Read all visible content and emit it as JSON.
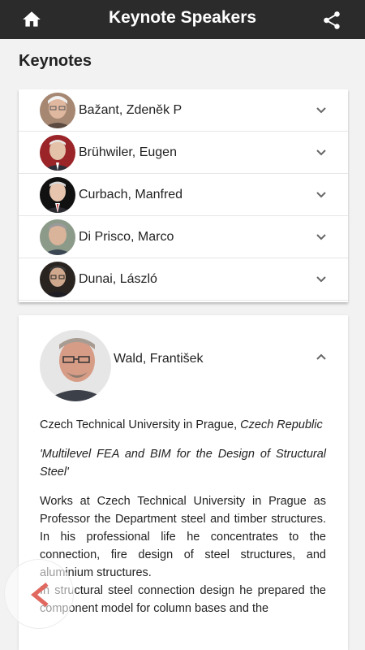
{
  "header": {
    "title": "Keynote Speakers",
    "home_icon": "home-icon",
    "share_icon": "share-icon"
  },
  "section_title": "Keynotes",
  "speakers": [
    {
      "name": "Bažant, Zdeněk P",
      "expanded": false
    },
    {
      "name": "Brühwiler, Eugen",
      "expanded": false
    },
    {
      "name": "Curbach, Manfred",
      "expanded": false
    },
    {
      "name": "Di Prisco, Marco",
      "expanded": false
    },
    {
      "name": "Dunai, László",
      "expanded": false
    }
  ],
  "expanded_speaker": {
    "name": "Wald, František",
    "affiliation_plain": "Czech Technical University in Prague,",
    "affiliation_country": "Czech Republic",
    "talk_title": "'Multilevel FEA and BIM for the Design of Structural Steel'",
    "bio_1": "Works at Czech Technical University in Prague as Professor the Department steel and timber structures. In his professional life he concentrates to the connection, fire design of steel structures, and aluminium structures.",
    "bio_2": "In structural steel connection design he prepared the component model for column bases and the"
  },
  "colors": {
    "topbar": "#2b2b2b",
    "background": "#f2f2f2",
    "card": "#ffffff",
    "back_arrow": "#e0685f"
  },
  "back_button_icon": "chevron-left-icon"
}
